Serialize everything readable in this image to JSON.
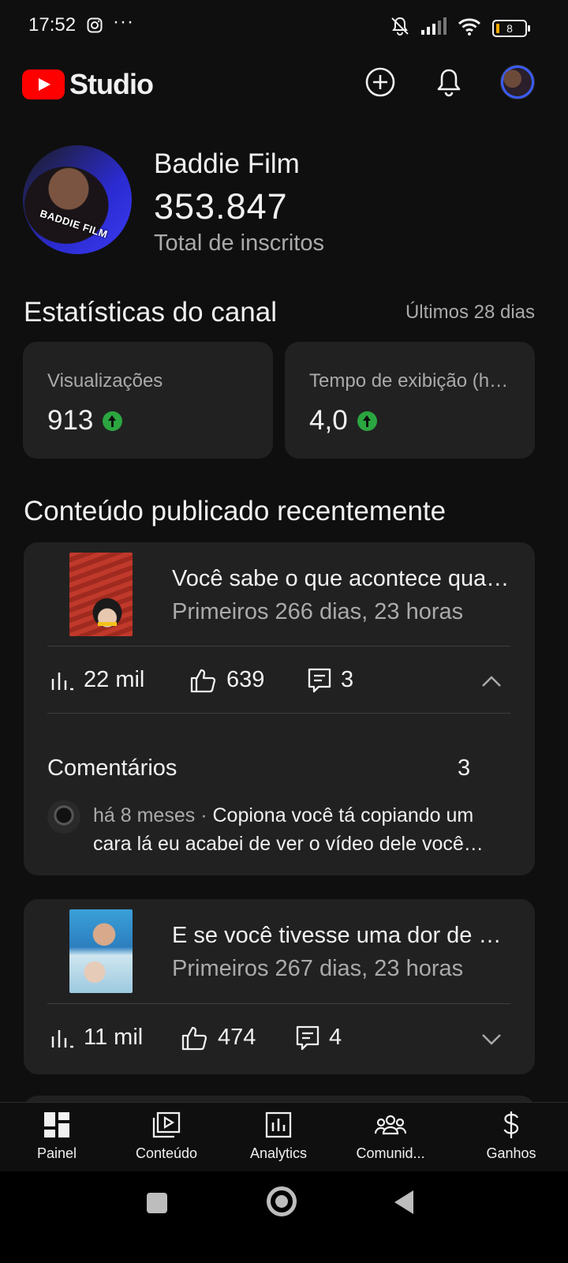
{
  "status_bar": {
    "time": "17:52",
    "dots": "···",
    "battery": "8",
    "icons": [
      "instagram-icon",
      "mute-bell-icon",
      "signal-icon",
      "wifi-icon",
      "battery-icon"
    ]
  },
  "app_bar": {
    "brand": "Studio",
    "actions": [
      "create-icon",
      "notifications-icon",
      "account-avatar"
    ]
  },
  "channel": {
    "name": "Baddie Film",
    "subscribers": "353.847",
    "subscribers_label": "Total de inscritos",
    "avatar_watermark": "BADDIE FILM"
  },
  "stats": {
    "title": "Estatísticas do canal",
    "period": "Últimos 28 dias",
    "cards": [
      {
        "label": "Visualizações",
        "value": "913",
        "trend": "up"
      },
      {
        "label": "Tempo de exibição (horas)",
        "value": "4,0",
        "trend": "up"
      }
    ]
  },
  "recent": {
    "title": "Conteúdo publicado recentemente",
    "videos": [
      {
        "title": "Você sabe o que acontece quando",
        "subtitle": "Primeiros 266 dias, 23 horas",
        "views": "22 mil",
        "likes": "639",
        "comments": "3",
        "expanded": true,
        "comments_label": "Comentários",
        "comments_count": "3",
        "top_comment": {
          "time": "há 8 meses",
          "separator": "·",
          "text": "Copiona você tá copiando um cara lá eu acabei de ver o vídeo dele você copiou tudo"
        }
      },
      {
        "title": "E se você tivesse uma dor de dente",
        "subtitle": "Primeiros 267 dias, 23 horas",
        "views": "11 mil",
        "likes": "474",
        "comments": "4",
        "expanded": false
      }
    ]
  },
  "bottom_nav": [
    {
      "label": "Painel",
      "icon": "dashboard-icon",
      "active": true
    },
    {
      "label": "Conteúdo",
      "icon": "content-icon",
      "active": false
    },
    {
      "label": "Analytics",
      "icon": "analytics-icon",
      "active": false
    },
    {
      "label": "Comunid...",
      "icon": "community-icon",
      "active": false
    },
    {
      "label": "Ganhos",
      "icon": "earn-icon",
      "active": false
    }
  ],
  "colors": {
    "background": "#0f0f0f",
    "card": "#212121",
    "brand_red": "#ff0000",
    "trend_up": "#2ba640",
    "secondary_text": "#aaaaaa"
  }
}
